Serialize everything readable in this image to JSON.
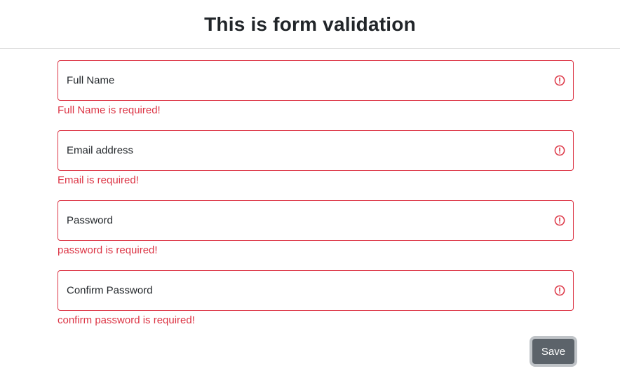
{
  "page": {
    "title": "This is form validation"
  },
  "form": {
    "fields": [
      {
        "label": "Full Name",
        "error": "Full Name is required!",
        "value": ""
      },
      {
        "label": "Email address",
        "error": "Email is required!",
        "value": ""
      },
      {
        "label": "Password",
        "error": "password is required!",
        "value": ""
      },
      {
        "label": "Confirm Password",
        "error": "confirm password is required!",
        "value": ""
      }
    ],
    "save_label": "Save"
  },
  "colors": {
    "error": "#dc3545",
    "button_bg": "#5c636a",
    "button_focus_ring": "#bfc3c7"
  },
  "icons": {
    "invalid": "exclamation-circle-icon"
  }
}
